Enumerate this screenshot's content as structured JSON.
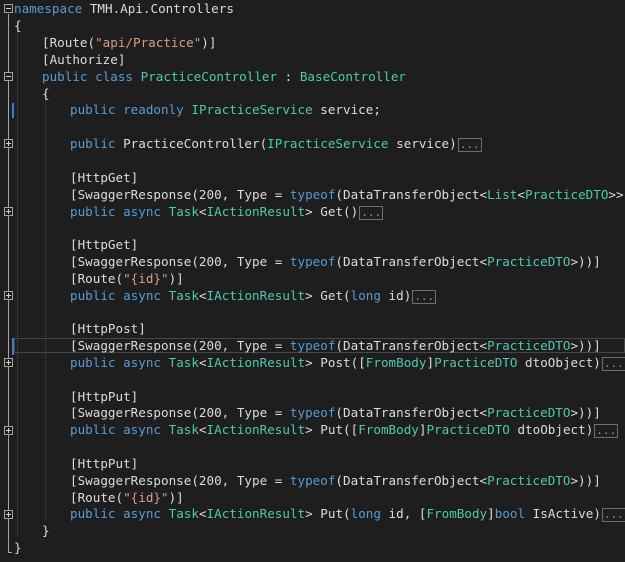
{
  "editor": {
    "namespace_keyword": "namespace",
    "namespace_name": "TMH.Api.Controllers",
    "open_brace": "{",
    "close_brace": "}",
    "ellipsis": "...",
    "attr_route_open": "[Route(",
    "attr_route_value": "\"api/Practice\"",
    "attr_close": ")]",
    "attr_authorize": "[Authorize]",
    "class_public": "public",
    "class_keyword": "class",
    "class_name": "PracticeController",
    "class_colon": " : ",
    "base_class": "BaseController",
    "field_public": "public",
    "field_readonly": "readonly",
    "field_type": "IPracticeService",
    "field_name": " service;",
    "ctor_public": "public",
    "ctor_sig": "PracticeController(",
    "ctor_param_type": "IPracticeService",
    "ctor_param_rest": " service)",
    "http_get": "[HttpGet]",
    "http_post": "[HttpPost]",
    "http_put": "[HttpPut]",
    "swagger_open": "[SwaggerResponse(",
    "swagger_200_type": "200, Type = ",
    "typeof_kw": "typeof",
    "dto_open": "(DataTransferObject<",
    "list_type": "List",
    "lt": "<",
    "practice_dto": "PracticeDTO",
    "close_3": ">>))]",
    "close_2": ">))]",
    "route_open": "[Route(",
    "route_id": "\"{id}\"",
    "public_kw": "public",
    "async_kw": "async",
    "task_type": "Task",
    "action_result": "IActionResult",
    "get_sig_1": "> Get()",
    "get_sig_2a": "> Get(",
    "long_kw": "long",
    "get_sig_2b": " id)",
    "post_sig_a": "> Post([",
    "from_body": "FromBody",
    "post_sig_b": "]",
    "post_sig_c": " dtoObject)",
    "put_sig_a": "> Put([",
    "put2_sig_a": "> Put(",
    "put2_sig_b": " id, [",
    "bool_kw": "bool",
    "put2_sig_c": " IsActive)"
  },
  "colors": {
    "background": "#1e1e1e",
    "keyword": "#569cd6",
    "type": "#4ec9b0",
    "string": "#d69d85",
    "text": "#dcdcdc"
  }
}
